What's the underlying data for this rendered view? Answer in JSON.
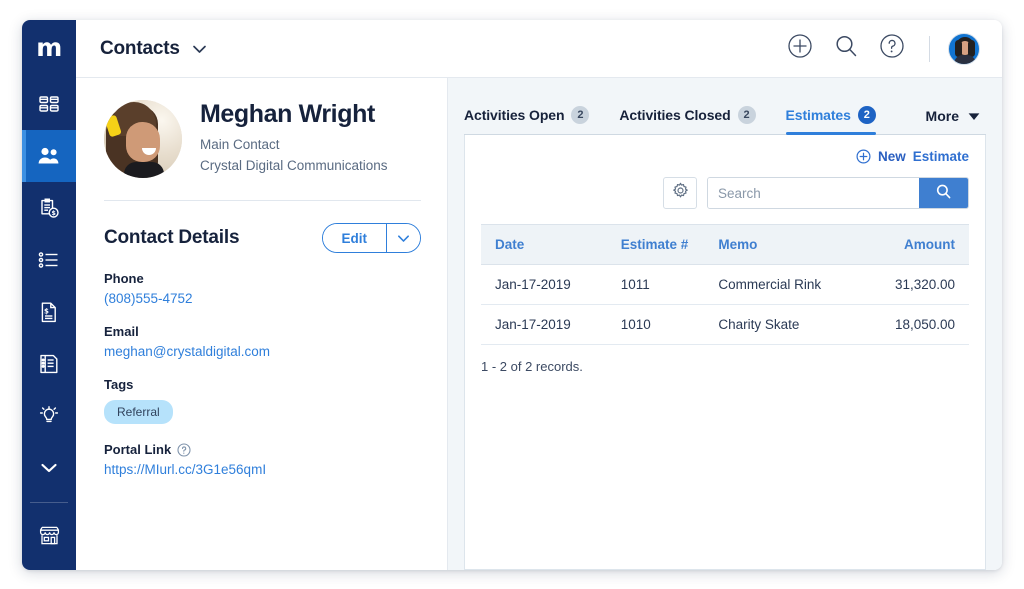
{
  "brand": {
    "logo_text": "m"
  },
  "topbar": {
    "module_title": "Contacts",
    "module_caret_icon": "chevron-down-icon",
    "add_icon": "plus-circle-icon",
    "search_icon": "search-icon",
    "help_icon": "question-circle-icon",
    "avatar_icon": "user-avatar"
  },
  "sidebar": {
    "items": [
      {
        "name": "dashboard",
        "icon": "grid-squares-icon",
        "active": false
      },
      {
        "name": "contacts",
        "icon": "people-icon",
        "active": true
      },
      {
        "name": "estimates",
        "icon": "clipboard-dollar-icon",
        "active": false
      },
      {
        "name": "lists",
        "icon": "bullet-list-icon",
        "active": false
      },
      {
        "name": "invoices",
        "icon": "document-dollar-icon",
        "active": false
      },
      {
        "name": "ledger",
        "icon": "ledger-page-icon",
        "active": false
      },
      {
        "name": "insights",
        "icon": "lightbulb-icon",
        "active": false
      },
      {
        "name": "more",
        "icon": "chevron-down-icon",
        "active": false
      },
      {
        "name": "storefront",
        "icon": "storefront-icon",
        "active": false
      }
    ]
  },
  "contact": {
    "photo_icon": "contact-photo",
    "name": "Meghan Wright",
    "role": "Main Contact",
    "company": "Crystal Digital Communications",
    "details_title": "Contact Details",
    "edit_label": "Edit",
    "edit_caret_icon": "chevron-down-icon",
    "fields": [
      {
        "label": "Phone",
        "value": "(808)555-4752",
        "type": "link"
      },
      {
        "label": "Email",
        "value": "meghan@crystaldigital.com",
        "type": "link"
      }
    ],
    "tags_label": "Tags",
    "tags": [
      "Referral"
    ],
    "portal_label": "Portal Link",
    "portal_help_icon": "question-circle-icon",
    "portal_url": "https://MIurl.cc/3G1e56qmI"
  },
  "tabs": [
    {
      "label": "Activities Open",
      "count": "2",
      "active": false
    },
    {
      "label": "Activities Closed",
      "count": "2",
      "active": false
    },
    {
      "label": "Estimates",
      "count": "2",
      "active": true
    }
  ],
  "more_tab": {
    "label": "More",
    "icon": "caret-down-icon"
  },
  "panel": {
    "new_plus_icon": "plus-circle-icon",
    "new_label": "New",
    "new_object_label": "Estimate",
    "gear_icon": "gear-icon",
    "search_placeholder": "Search",
    "search_value": "",
    "search_submit_icon": "search-icon",
    "record_count": "1 - 2 of 2 records."
  },
  "table": {
    "columns": [
      "Date",
      "Estimate #",
      "Memo",
      "Amount"
    ],
    "rows": [
      {
        "date": "Jan-17-2019",
        "number": "1011",
        "memo": "Commercial Rink",
        "amount": "31,320.00"
      },
      {
        "date": "Jan-17-2019",
        "number": "1010",
        "memo": "Charity Skate",
        "amount": "18,050.00"
      }
    ]
  },
  "colors": {
    "sidebar_bg": "#12306e",
    "sidebar_active": "#1565c0",
    "accent_blue": "#2f7fdb",
    "link_blue": "#2f6fd0",
    "panel_bg": "#f2f6f9",
    "tag_bg": "#b6e2fb",
    "badge_active": "#1e63c4",
    "text_dark": "#16223c"
  }
}
